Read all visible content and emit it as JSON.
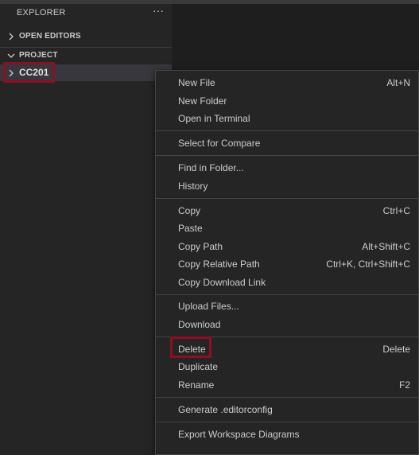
{
  "explorer": {
    "title": "EXPLORER",
    "more_label": "···"
  },
  "sections": {
    "open_editors": {
      "label": "OPEN EDITORS",
      "icon": "chevron-right-icon"
    },
    "project": {
      "label": "PROJECT",
      "icon": "chevron-down-icon"
    }
  },
  "tree": {
    "root_folder": {
      "label": "CC201",
      "icon": "chevron-right-icon"
    }
  },
  "context_menu": {
    "items": [
      {
        "label": "New File",
        "shortcut": "Alt+N"
      },
      {
        "label": "New Folder",
        "shortcut": ""
      },
      {
        "label": "Open in Terminal",
        "shortcut": ""
      },
      {
        "label": "Select for Compare",
        "shortcut": ""
      },
      {
        "label": "Find in Folder...",
        "shortcut": ""
      },
      {
        "label": "History",
        "shortcut": ""
      },
      {
        "label": "Copy",
        "shortcut": "Ctrl+C"
      },
      {
        "label": "Paste",
        "shortcut": ""
      },
      {
        "label": "Copy Path",
        "shortcut": "Alt+Shift+C"
      },
      {
        "label": "Copy Relative Path",
        "shortcut": "Ctrl+K, Ctrl+Shift+C"
      },
      {
        "label": "Copy Download Link",
        "shortcut": ""
      },
      {
        "label": "Upload Files...",
        "shortcut": ""
      },
      {
        "label": "Download",
        "shortcut": ""
      },
      {
        "label": "Delete",
        "shortcut": "Delete"
      },
      {
        "label": "Duplicate",
        "shortcut": ""
      },
      {
        "label": "Rename",
        "shortcut": "F2"
      },
      {
        "label": "Generate .editorconfig",
        "shortcut": ""
      },
      {
        "label": "Export Workspace Diagrams",
        "shortcut": ""
      }
    ]
  },
  "colors": {
    "sidebar_bg": "#252526",
    "editor_bg": "#1e1e1e",
    "selected_row_bg": "#37373d",
    "highlight_border": "#8a1121",
    "menu_separator": "#454545"
  }
}
